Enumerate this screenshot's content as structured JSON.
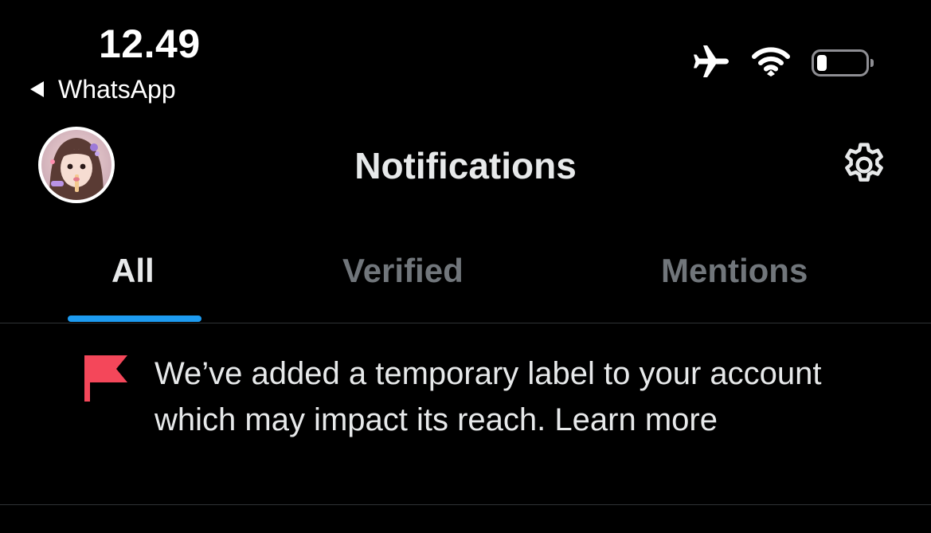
{
  "status_bar": {
    "time": "12.49",
    "back_app": "WhatsApp",
    "icons": [
      "airplane-icon",
      "wifi-icon",
      "battery-icon"
    ],
    "battery_level": 0.2
  },
  "header": {
    "title": "Notifications",
    "avatar": "profile-avatar",
    "settings_icon": "gear-icon"
  },
  "tabs": [
    {
      "label": "All",
      "active": true
    },
    {
      "label": "Verified",
      "active": false
    },
    {
      "label": "Mentions",
      "active": false
    }
  ],
  "notification": {
    "icon": "flag-icon",
    "text": "We’ve added a temporary label to your account which may impact its reach.",
    "link": "Learn more"
  },
  "colors": {
    "background": "#000000",
    "text": "#e7e9ea",
    "muted": "#71767b",
    "accent": "#1d9bf0",
    "flag": "#f4475a",
    "divider": "#2f3336"
  }
}
